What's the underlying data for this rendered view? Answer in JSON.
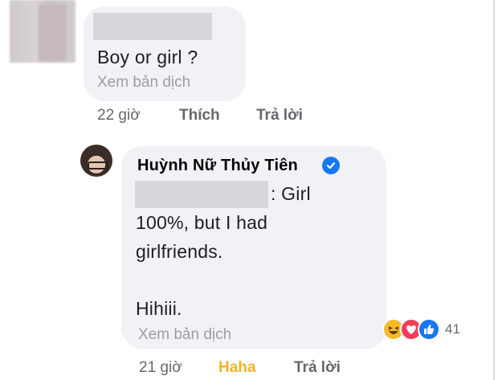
{
  "comment": {
    "text": "Boy or girl ?",
    "see_translation": "Xem bản dịch",
    "time": "22 giờ",
    "like_label": "Thích",
    "reply_label": "Trả lời"
  },
  "reply": {
    "author": "Huỳnh Nữ Thủy Tiên",
    "line1_suffix": ": Girl",
    "line2": "100%, but I had",
    "line3": "girlfriends.",
    "line4": "Hihiii.",
    "see_translation": "Xem bản dịch",
    "time": "21 giờ",
    "reaction_label": "Haha",
    "reply_label": "Trả lời",
    "reaction_count": "41",
    "reaction_icons": [
      "haha-icon",
      "love-icon",
      "like-icon"
    ],
    "colors": {
      "haha": "#f7b125",
      "verified": "#1877f2",
      "love": "#f33e58",
      "like": "#1877f2"
    }
  }
}
